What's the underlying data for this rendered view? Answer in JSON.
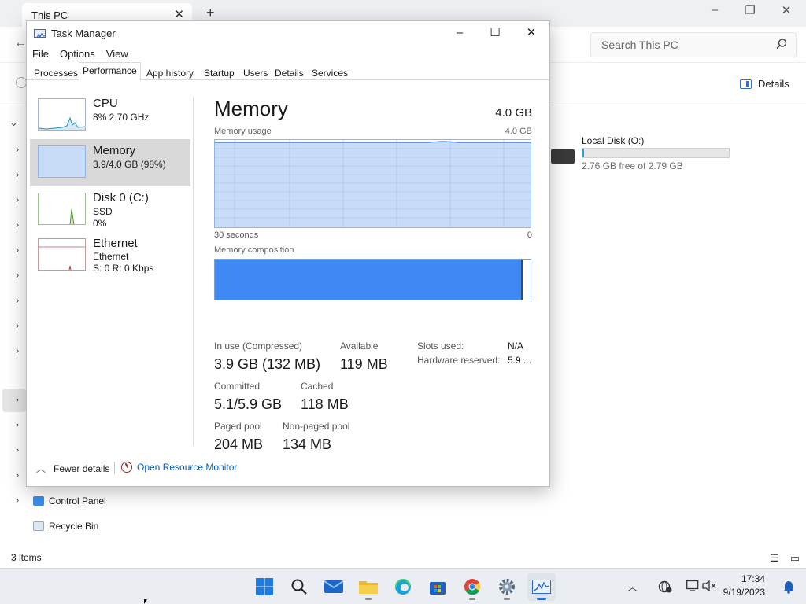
{
  "explorer": {
    "tab_title": "This PC",
    "search_placeholder": "Search This PC",
    "details_label": "Details",
    "nav": {
      "control_panel": "Control Panel",
      "recycle_bin": "Recycle Bin"
    },
    "drive": {
      "name": "Local Disk (O:)",
      "free_text": "2.76 GB free of 2.79 GB",
      "used_fraction": 0.01
    },
    "status_items": "3 items"
  },
  "taskmgr": {
    "title": "Task Manager",
    "menu": [
      "File",
      "Options",
      "View"
    ],
    "tabs": [
      "Processes",
      "Performance",
      "App history",
      "Startup",
      "Users",
      "Details",
      "Services"
    ],
    "active_tab": "Performance",
    "resources": [
      {
        "name": "CPU",
        "line1": "8%  2.70 GHz",
        "line2": ""
      },
      {
        "name": "Memory",
        "line1": "3.9/4.0 GB (98%)",
        "line2": ""
      },
      {
        "name": "Disk 0 (C:)",
        "line1": "SSD",
        "line2": "0%"
      },
      {
        "name": "Ethernet",
        "line1": "Ethernet",
        "line2": "S: 0  R: 0 Kbps"
      }
    ],
    "memory": {
      "title": "Memory",
      "total": "4.0 GB",
      "usage_label": "Memory usage",
      "usage_max": "4.0 GB",
      "time_left": "30 seconds",
      "time_right": "0",
      "composition_label": "Memory composition",
      "in_use_fraction": 0.975,
      "stats": {
        "in_use_label": "In use (Compressed)",
        "in_use": "3.9 GB (132 MB)",
        "available_label": "Available",
        "available": "119 MB",
        "committed_label": "Committed",
        "committed": "5.1/5.9 GB",
        "cached_label": "Cached",
        "cached": "118 MB",
        "paged_label": "Paged pool",
        "paged": "204 MB",
        "nonpaged_label": "Non-paged pool",
        "nonpaged": "134 MB",
        "slots_label": "Slots used:",
        "slots": "N/A",
        "hw_label": "Hardware reserved:",
        "hw": "5.9 ..."
      }
    },
    "footer": {
      "fewer": "Fewer details",
      "resmon": "Open Resource Monitor"
    }
  },
  "taskbar": {
    "apps": [
      "start",
      "search",
      "mail",
      "file-explorer",
      "edge",
      "store",
      "chrome",
      "settings",
      "task-manager"
    ],
    "time": "17:34",
    "date": "9/19/2023"
  },
  "colors": {
    "accent": "#2f6fd1",
    "memory_fill": "#3e89f4",
    "memory_graph": "#c9dcf7"
  }
}
